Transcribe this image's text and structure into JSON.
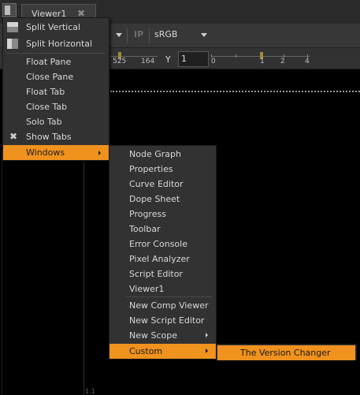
{
  "tab": {
    "title": "Viewer1",
    "close_glyph": "✖"
  },
  "toolbar": {
    "ip_label": "IP",
    "colorspace": "sRGB",
    "exposure_scale": [
      "525",
      "164"
    ],
    "y_label": "Y",
    "y_value": "1",
    "gamma_scale": [
      "0",
      "1",
      "2",
      "4"
    ]
  },
  "canvas": {
    "corner_text": "1.1"
  },
  "pane_menu": {
    "split_vertical": "Split Vertical",
    "split_horizontal": "Split Horizontal",
    "float_pane": "Float Pane",
    "close_pane": "Close Pane",
    "float_tab": "Float Tab",
    "close_tab": "Close Tab",
    "solo_tab": "Solo Tab",
    "show_tabs": "Show Tabs",
    "show_tabs_check": "✖",
    "windows": "Windows"
  },
  "windows_menu": {
    "node_graph": "Node Graph",
    "properties": "Properties",
    "curve_editor": "Curve Editor",
    "dope_sheet": "Dope Sheet",
    "progress": "Progress",
    "toolbar": "Toolbar",
    "error_console": "Error Console",
    "pixel_analyzer": "Pixel Analyzer",
    "script_editor": "Script Editor",
    "viewer1": "Viewer1",
    "new_comp_viewer": "New Comp Viewer",
    "new_script_editor": "New Script Editor",
    "new_scope": "New Scope",
    "custom": "Custom"
  },
  "custom_menu": {
    "version_changer": "The Version Changer"
  },
  "colors": {
    "highlight": "#f0921e",
    "menu_bg": "#323232",
    "toolbar_bg": "#373737"
  }
}
